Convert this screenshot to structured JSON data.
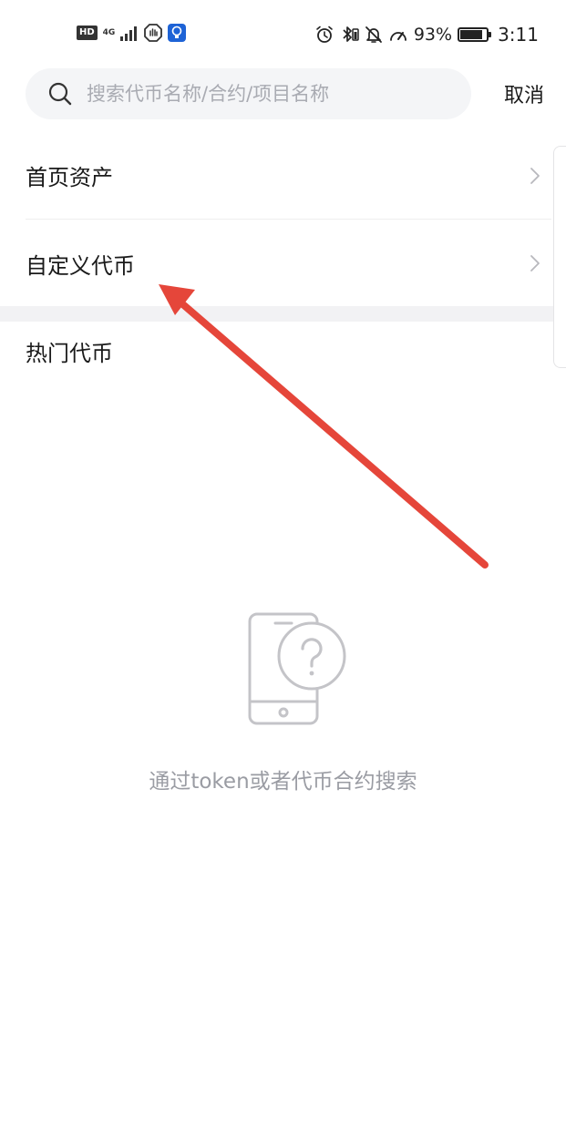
{
  "status_bar": {
    "hd_label": "HD",
    "network_label": "4G",
    "battery_percent": 93,
    "battery_text": "93%",
    "time": "3:11",
    "icons": [
      "hd-icon",
      "signal-icon",
      "vpn-hand-icon",
      "bulb-app-icon",
      "alarm-icon",
      "bluetooth-icon",
      "mute-bell-icon",
      "speed-gauge-icon",
      "battery-icon"
    ]
  },
  "search": {
    "placeholder": "搜索代币名称/合约/项目名称",
    "value": "",
    "cancel_label": "取消"
  },
  "menu": {
    "items": [
      {
        "label": "首页资产"
      },
      {
        "label": "自定义代币"
      }
    ]
  },
  "hot": {
    "title": "热门代币"
  },
  "empty_state": {
    "text": "通过token或者代币合约搜索",
    "icon": "phone-question-icon"
  },
  "colors": {
    "arrow": "#e5463a",
    "placeholder": "#a9abb2",
    "search_bg": "#f4f5f7",
    "divider": "#f2f2f4",
    "empty_text": "#9a9ca3"
  }
}
